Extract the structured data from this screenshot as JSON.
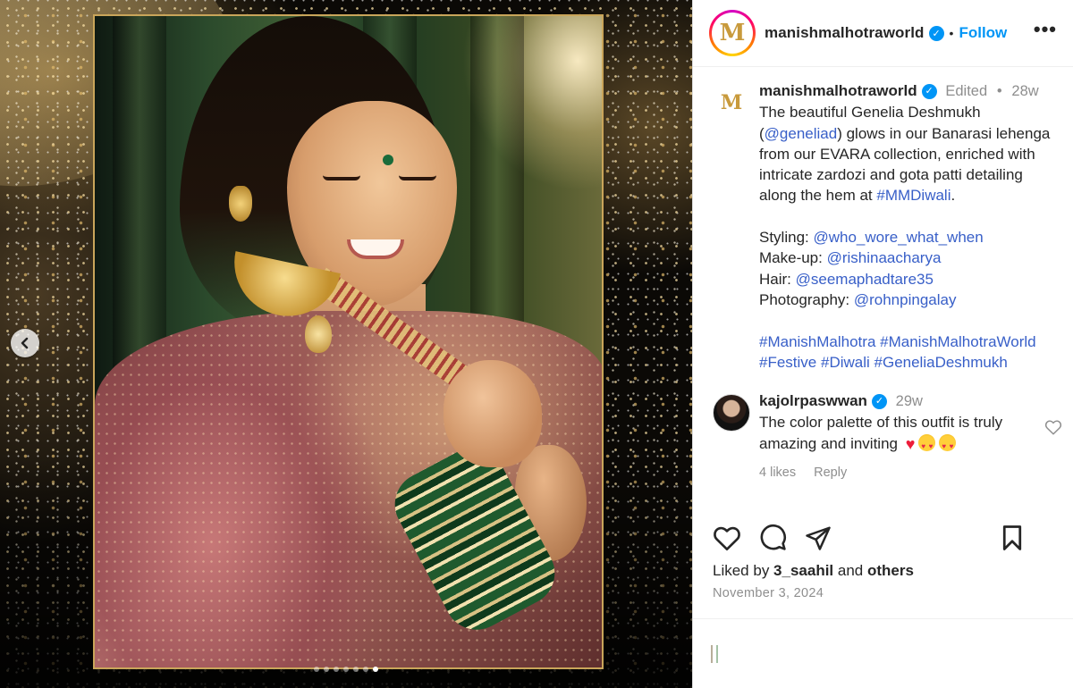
{
  "header": {
    "username": "manishmalhotraworld",
    "separator": "•",
    "follow_label": "Follow",
    "more_label": "•••",
    "logo_letter": "M"
  },
  "caption": {
    "username": "manishmalhotraworld",
    "edited": "Edited",
    "dot": "•",
    "age": "28w",
    "text_1": "The beautiful Genelia Deshmukh (",
    "mention_main": "@geneliad",
    "text_2": ") glows in our Banarasi lehenga from our EVARA collection, enriched with intricate zardozi and gota patti detailing along the hem at ",
    "hashtag_main": "#MMDiwali",
    "text_3": ".",
    "credits": [
      {
        "label": "Styling: ",
        "handle": "@who_wore_what_when"
      },
      {
        "label": "Make-up: ",
        "handle": "@rishinaacharya"
      },
      {
        "label": "Hair: ",
        "handle": "@seemaphadtare35"
      },
      {
        "label": "Photography: ",
        "handle": "@rohnpingalay"
      }
    ],
    "hashtags": [
      "#ManishMalhotra",
      "#ManishMalhotraWorld",
      "#Festive",
      "#Diwali",
      "#GeneliaDeshmukh"
    ]
  },
  "comment": {
    "username": "kajolrpaswwan",
    "age": "29w",
    "text": "The color palette of this outfit is truly amazing and inviting",
    "emoji": [
      "red-heart",
      "heart-eyes",
      "heart-eyes"
    ],
    "likes": "4 likes",
    "reply_label": "Reply"
  },
  "footer": {
    "liked_prefix": "Liked by ",
    "liked_user": "3_saahil",
    "liked_mid": " and ",
    "liked_others": "others",
    "date": "November 3, 2024"
  },
  "carousel": {
    "total_slides": 7,
    "active_slide": 7
  },
  "colors": {
    "link": "#385fc8",
    "follow": "#0095f6",
    "verified": "#0095f6",
    "muted": "#8e8e8e",
    "gold": "#c89a3c"
  },
  "icons": [
    "chevron-left-icon",
    "verified-badge-icon",
    "heart-icon",
    "comment-icon",
    "share-icon",
    "bookmark-icon",
    "more-icon"
  ]
}
